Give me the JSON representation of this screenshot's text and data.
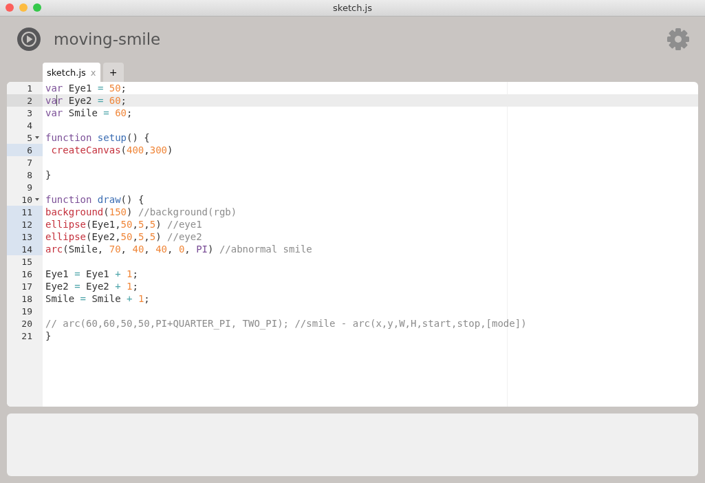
{
  "window": {
    "title": "sketch.js"
  },
  "header": {
    "sketch_name": "moving-smile"
  },
  "tabs": [
    {
      "label": "sketch.js",
      "close": "x",
      "selected": true,
      "kind": "file"
    },
    {
      "label": "+",
      "selected": false,
      "kind": "add"
    }
  ],
  "editor": {
    "lines": [
      {
        "number": "1",
        "active": false,
        "selected": false,
        "foldable": false,
        "tokens": [
          {
            "kind": "keyword",
            "text": "var"
          },
          {
            "kind": "plain",
            "text": " Eye1 "
          },
          {
            "kind": "operator",
            "text": "="
          },
          {
            "kind": "number",
            "text": " 50"
          },
          {
            "kind": "plain",
            "text": ";"
          }
        ]
      },
      {
        "number": "2",
        "active": true,
        "selected": false,
        "foldable": false,
        "tokens": [
          {
            "kind": "keyword",
            "text": "va"
          },
          {
            "kind": "keyword",
            "text": "r",
            "cursor": true
          },
          {
            "kind": "plain",
            "text": " Eye2 "
          },
          {
            "kind": "operator",
            "text": "="
          },
          {
            "kind": "number",
            "text": " 60"
          },
          {
            "kind": "plain",
            "text": ";"
          }
        ]
      },
      {
        "number": "3",
        "active": false,
        "selected": false,
        "foldable": false,
        "tokens": [
          {
            "kind": "keyword",
            "text": "var"
          },
          {
            "kind": "plain",
            "text": " Smile "
          },
          {
            "kind": "operator",
            "text": "="
          },
          {
            "kind": "number",
            "text": " 60"
          },
          {
            "kind": "plain",
            "text": ";"
          }
        ]
      },
      {
        "number": "4",
        "active": false,
        "selected": false,
        "foldable": false
      },
      {
        "number": "5",
        "active": false,
        "selected": false,
        "foldable": true,
        "tokens": [
          {
            "kind": "keyword",
            "text": "function"
          },
          {
            "kind": "def",
            "text": " setup"
          },
          {
            "kind": "plain",
            "text": "() {"
          }
        ]
      },
      {
        "number": "6",
        "active": false,
        "selected": true,
        "foldable": false,
        "tokens": [
          {
            "kind": "builtin",
            "text": " createCanvas"
          },
          {
            "kind": "plain",
            "text": "("
          },
          {
            "kind": "number",
            "text": "400"
          },
          {
            "kind": "plain",
            "text": ","
          },
          {
            "kind": "number",
            "text": "300"
          },
          {
            "kind": "plain",
            "text": ")"
          }
        ]
      },
      {
        "number": "7",
        "active": false,
        "selected": false,
        "foldable": false
      },
      {
        "number": "8",
        "active": false,
        "selected": false,
        "foldable": false,
        "tokens": [
          {
            "kind": "plain",
            "text": "}"
          }
        ]
      },
      {
        "number": "9",
        "active": false,
        "selected": false,
        "foldable": false
      },
      {
        "number": "10",
        "active": false,
        "selected": false,
        "foldable": true,
        "tokens": [
          {
            "kind": "keyword",
            "text": "function"
          },
          {
            "kind": "def",
            "text": " draw"
          },
          {
            "kind": "plain",
            "text": "() {"
          }
        ]
      },
      {
        "number": "11",
        "active": false,
        "selected": true,
        "foldable": false,
        "tokens": [
          {
            "kind": "builtin",
            "text": "background"
          },
          {
            "kind": "plain",
            "text": "("
          },
          {
            "kind": "number",
            "text": "150"
          },
          {
            "kind": "plain",
            "text": ") "
          },
          {
            "kind": "comment",
            "text": "//background(rgb)"
          }
        ]
      },
      {
        "number": "12",
        "active": false,
        "selected": true,
        "foldable": false,
        "tokens": [
          {
            "kind": "builtin",
            "text": "ellipse"
          },
          {
            "kind": "plain",
            "text": "(Eye1,"
          },
          {
            "kind": "number",
            "text": "50"
          },
          {
            "kind": "plain",
            "text": ","
          },
          {
            "kind": "number",
            "text": "5"
          },
          {
            "kind": "plain",
            "text": ","
          },
          {
            "kind": "number",
            "text": "5"
          },
          {
            "kind": "plain",
            "text": ") "
          },
          {
            "kind": "comment",
            "text": "//eye1"
          }
        ]
      },
      {
        "number": "13",
        "active": false,
        "selected": true,
        "foldable": false,
        "tokens": [
          {
            "kind": "builtin",
            "text": "ellipse"
          },
          {
            "kind": "plain",
            "text": "(Eye2,"
          },
          {
            "kind": "number",
            "text": "50"
          },
          {
            "kind": "plain",
            "text": ","
          },
          {
            "kind": "number",
            "text": "5"
          },
          {
            "kind": "plain",
            "text": ","
          },
          {
            "kind": "number",
            "text": "5"
          },
          {
            "kind": "plain",
            "text": ") "
          },
          {
            "kind": "comment",
            "text": "//eye2"
          }
        ]
      },
      {
        "number": "14",
        "active": false,
        "selected": true,
        "foldable": false,
        "tokens": [
          {
            "kind": "builtin",
            "text": "arc"
          },
          {
            "kind": "plain",
            "text": "(Smile, "
          },
          {
            "kind": "number",
            "text": "70"
          },
          {
            "kind": "plain",
            "text": ", "
          },
          {
            "kind": "number",
            "text": "40"
          },
          {
            "kind": "plain",
            "text": ", "
          },
          {
            "kind": "number",
            "text": "40"
          },
          {
            "kind": "plain",
            "text": ", "
          },
          {
            "kind": "number",
            "text": "0"
          },
          {
            "kind": "plain",
            "text": ", "
          },
          {
            "kind": "keyword",
            "text": "PI"
          },
          {
            "kind": "plain",
            "text": ") "
          },
          {
            "kind": "comment",
            "text": "//abnormal smile"
          }
        ]
      },
      {
        "number": "15",
        "active": false,
        "selected": false,
        "foldable": false
      },
      {
        "number": "16",
        "active": false,
        "selected": false,
        "foldable": false,
        "tokens": [
          {
            "kind": "plain",
            "text": "Eye1 "
          },
          {
            "kind": "operator",
            "text": "="
          },
          {
            "kind": "plain",
            "text": " Eye1 "
          },
          {
            "kind": "operator",
            "text": "+"
          },
          {
            "kind": "number",
            "text": " 1"
          },
          {
            "kind": "plain",
            "text": ";"
          }
        ]
      },
      {
        "number": "17",
        "active": false,
        "selected": false,
        "foldable": false,
        "tokens": [
          {
            "kind": "plain",
            "text": "Eye2 "
          },
          {
            "kind": "operator",
            "text": "="
          },
          {
            "kind": "plain",
            "text": " Eye2 "
          },
          {
            "kind": "operator",
            "text": "+"
          },
          {
            "kind": "number",
            "text": " 1"
          },
          {
            "kind": "plain",
            "text": ";"
          }
        ]
      },
      {
        "number": "18",
        "active": false,
        "selected": false,
        "foldable": false,
        "tokens": [
          {
            "kind": "plain",
            "text": "Smile "
          },
          {
            "kind": "operator",
            "text": "="
          },
          {
            "kind": "plain",
            "text": " Smile "
          },
          {
            "kind": "operator",
            "text": "+"
          },
          {
            "kind": "number",
            "text": " 1"
          },
          {
            "kind": "plain",
            "text": ";"
          }
        ]
      },
      {
        "number": "19",
        "active": false,
        "selected": false,
        "foldable": false
      },
      {
        "number": "20",
        "active": false,
        "selected": false,
        "foldable": false,
        "tokens": [
          {
            "kind": "comment",
            "text": "// arc(60,60,50,50,PI+QUARTER_PI, TWO_PI); //smile - arc(x,y,W,H,start,stop,[mode])"
          }
        ]
      },
      {
        "number": "21",
        "active": false,
        "selected": false,
        "foldable": false,
        "tokens": [
          {
            "kind": "plain",
            "text": "}"
          }
        ]
      }
    ]
  }
}
